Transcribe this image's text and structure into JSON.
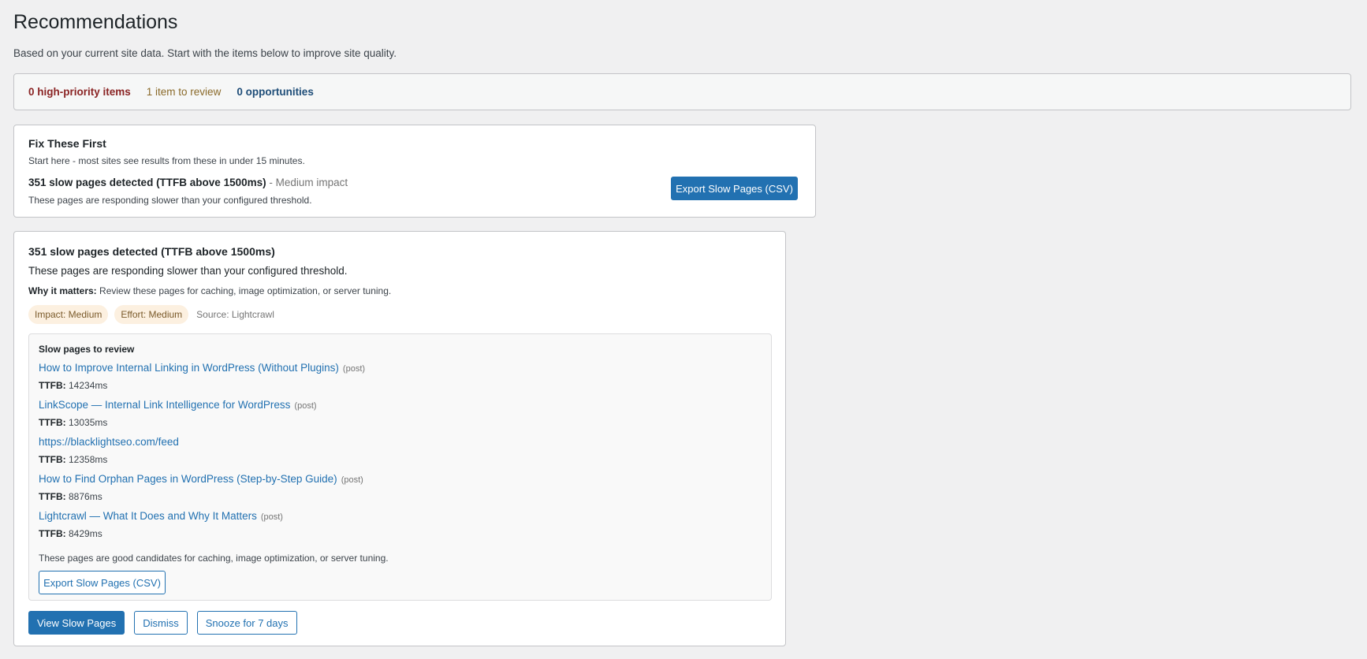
{
  "page": {
    "title": "Recommendations",
    "description": "Based on your current site data. Start with the items below to improve site quality."
  },
  "summary": {
    "high_priority": "0 high-priority items",
    "to_review": "1 item to review",
    "opportunities": "0 opportunities"
  },
  "fix_first": {
    "title": "Fix These First",
    "subtitle": "Start here - most sites see results from these in under 15 minutes.",
    "item_title": "351 slow pages detected (TTFB above 1500ms)",
    "item_impact": "- Medium impact",
    "item_desc": "These pages are responding slower than your configured threshold.",
    "export_button": "Export Slow Pages (CSV)"
  },
  "detail": {
    "title": "351 slow pages detected (TTFB above 1500ms)",
    "desc": "These pages are responding slower than your configured threshold.",
    "why_label": "Why it matters:",
    "why_text": "Review these pages for caching, image optimization, or server tuning.",
    "impact_badge": "Impact: Medium",
    "effort_badge": "Effort: Medium",
    "source": "Source: Lightcrawl",
    "slow_box": {
      "title": "Slow pages to review",
      "ttfb_label": "TTFB:",
      "items": [
        {
          "title": "How to Improve Internal Linking in WordPress (Without Plugins)",
          "type": "(post)",
          "ttfb": "14234ms"
        },
        {
          "title": "LinkScope — Internal Link Intelligence for WordPress",
          "type": "(post)",
          "ttfb": "13035ms"
        },
        {
          "title": "https://blacklightseo.com/feed",
          "type": "",
          "ttfb": "12358ms"
        },
        {
          "title": "How to Find Orphan Pages in WordPress (Step-by-Step Guide)",
          "type": "(post)",
          "ttfb": "8876ms"
        },
        {
          "title": "Lightcrawl — What It Does and Why It Matters",
          "type": "(post)",
          "ttfb": "8429ms"
        }
      ],
      "note": "These pages are good candidates for caching, image optimization, or server tuning.",
      "export_button": "Export Slow Pages (CSV)"
    },
    "actions": {
      "view": "View Slow Pages",
      "dismiss": "Dismiss",
      "snooze": "Snooze for 7 days"
    }
  },
  "colors": {
    "primary": "#2271b1",
    "high_priority": "#8a2424",
    "review": "#8a6a2a",
    "opportunities": "#1e4d78",
    "badge_bg": "#fcf0e0"
  }
}
